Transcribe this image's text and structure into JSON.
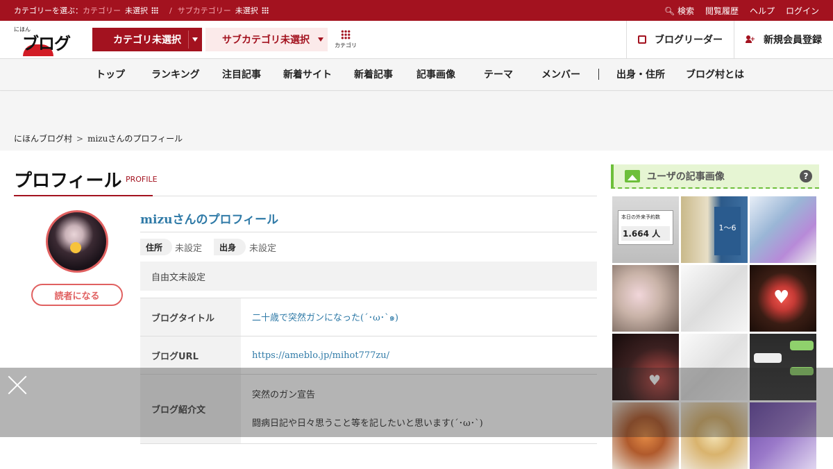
{
  "topbar": {
    "select_category": "カテゴリーを選ぶ：",
    "category": "カテゴリー",
    "unselected": "未選択",
    "separator": "/",
    "subcategory": "サブカテゴリー",
    "links": [
      "検索",
      "閲覧履歴",
      "ヘルプ",
      "ログイン"
    ]
  },
  "header": {
    "logo_small": "にほん",
    "logo_big": "ブログ村",
    "category_button": "カテゴリ未選択",
    "subcategory_button": "サブカテゴリ未選択",
    "category_grid_label": "カテゴリ",
    "blog_reader": "ブログリーダー",
    "register": "新規会員登録"
  },
  "nav": [
    "トップ",
    "ランキング",
    "注目記事",
    "新着サイト",
    "新着記事",
    "記事画像",
    "テーマ",
    "メンバー",
    "出身・住所",
    "ブログ村とは"
  ],
  "breadcrumb": {
    "home": "にほんブログ村",
    "sep": ">",
    "current": "mizuさんのプロフィール"
  },
  "profile": {
    "title": "プロフィール",
    "subtitle": "PROFILE",
    "name": "mizuさんのプロフィール",
    "reader_button": "読者になる",
    "address_label": "住所",
    "address_value": "未設定",
    "origin_label": "出身",
    "origin_value": "未設定",
    "free_text": "自由文未設定",
    "rows": [
      {
        "label": "ブログタイトル",
        "value": "二十歳で突然ガンになった(´･ω･`๑)"
      },
      {
        "label": "ブログURL",
        "value": "https://ameblo.jp/mihot777zu/"
      },
      {
        "label": "ブログ紹介文",
        "value": "突然のガン宣告",
        "value2": "闘病日記や日々思うこと等を記したいと思います(´･ω･`)"
      }
    ]
  },
  "sidebar": {
    "heading": "ユーザの記事画像",
    "help": "?",
    "thumb_1_caption": "本日の外来予約数",
    "thumb_1_value": "1.664 人",
    "thumb_2_text": "1〜6"
  },
  "colors": {
    "brand": "#a3121f",
    "accent_green": "#6dbf3a",
    "link": "#2f7aa7",
    "reader": "#e06060"
  }
}
